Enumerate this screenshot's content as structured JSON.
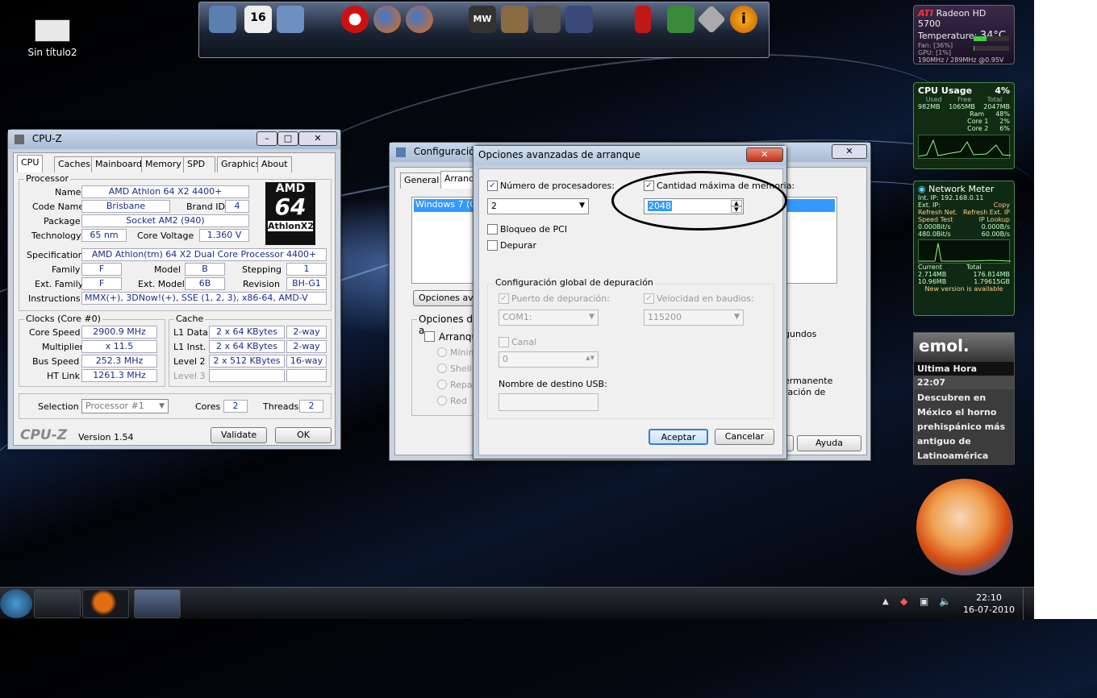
{
  "desktop": {
    "icon_label": "Sin título2"
  },
  "cpuz": {
    "title": "CPU-Z",
    "tabs": [
      "CPU",
      "Caches",
      "Mainboard",
      "Memory",
      "SPD",
      "Graphics",
      "About"
    ],
    "processor_group": "Processor",
    "name_label": "Name",
    "name": "AMD Athlon 64 X2 4400+",
    "codename_label": "Code Name",
    "codename": "Brisbane",
    "brandid_label": "Brand ID",
    "brandid": "4",
    "package_label": "Package",
    "package": "Socket AM2 (940)",
    "technology_label": "Technology",
    "technology": "65 nm",
    "voltage_label": "Core Voltage",
    "voltage": "1.360 V",
    "spec_label": "Specification",
    "spec": "AMD Athlon(tm) 64 X2 Dual Core Processor 4400+",
    "family_label": "Family",
    "family": "F",
    "model_label": "Model",
    "model": "B",
    "stepping_label": "Stepping",
    "stepping": "1",
    "extfamily_label": "Ext. Family",
    "extfamily": "F",
    "extmodel_label": "Ext. Model",
    "extmodel": "6B",
    "revision_label": "Revision",
    "revision": "BH-G1",
    "instructions_label": "Instructions",
    "instructions": "MMX(+), 3DNow!(+), SSE (1, 2, 3), x86-64, AMD-V",
    "logo_line1": "AMD",
    "logo_line2": "64",
    "logo_line3": "AthlonX2",
    "clocks_group": "Clocks (Core #0)",
    "corespeed_label": "Core Speed",
    "corespeed": "2900.9 MHz",
    "multiplier_label": "Multiplier",
    "multiplier": "x 11.5",
    "busspeed_label": "Bus Speed",
    "busspeed": "252.3 MHz",
    "htlink_label": "HT Link",
    "htlink": "1261.3 MHz",
    "cache_group": "Cache",
    "l1d_label": "L1 Data",
    "l1d": "2 x 64 KBytes",
    "l1d_way": "2-way",
    "l1i_label": "L1 Inst.",
    "l1i": "2 x 64 KBytes",
    "l1i_way": "2-way",
    "l2_label": "Level 2",
    "l2": "2 x 512 KBytes",
    "l2_way": "16-way",
    "l3_label": "Level 3",
    "selection_label": "Selection",
    "selection": "Processor #1",
    "cores_label": "Cores",
    "cores": "2",
    "threads_label": "Threads",
    "threads": "2",
    "brand": "CPU-Z",
    "version": "Version 1.54",
    "validate": "Validate",
    "ok": "OK"
  },
  "config": {
    "title": "Configuración",
    "tabs": [
      "General",
      "Arranque"
    ],
    "list_item": "Windows 7 (C:",
    "advanced_btn": "Opciones avan",
    "boot_options_label": "Opciones de a",
    "safe_boot": "Arranque",
    "radios": [
      "Mínimo",
      "Shell a",
      "Repar",
      "Red"
    ],
    "seconds_text": "gundos",
    "perm_text1": "ermanente",
    "perm_text2": "ración de",
    "help": "Ayuda"
  },
  "advanced": {
    "title": "Opciones avanzadas de arranque",
    "num_procs_label": "Número de procesadores:",
    "num_procs_value": "2",
    "max_mem_label": "Cantidad máxima de memoria:",
    "max_mem_value": "2048",
    "pci_lock": "Bloqueo de PCI",
    "debug": "Depurar",
    "debug_group": "Configuración global de depuración",
    "debug_port_label": "Puerto de depuración:",
    "debug_port_value": "COM1:",
    "baud_label": "Velocidad en baudios:",
    "baud_value": "115200",
    "channel_label": "Canal",
    "channel_value": "0",
    "usb_label": "Nombre de destino USB:",
    "accept": "Aceptar",
    "cancel": "Cancelar"
  },
  "gadgets": {
    "ati_brand": "ATI",
    "ati_title": "Radeon HD 5700",
    "ati_temp_label": "Temperature:",
    "ati_temp": "34°C",
    "ati_fan": "Fan: [36%]",
    "ati_gpu": "GPU: [1%]",
    "ati_clock": "190MHz / 289MHz @0.95V",
    "cpu_title": "CPU Usage",
    "cpu_pct": "4%",
    "cpu_used_label": "Used",
    "cpu_free_label": "Free",
    "cpu_total_label": "Total",
    "cpu_used": "982MB",
    "cpu_free": "1065MB",
    "cpu_total": "2047MB",
    "ram_label": "Ram",
    "ram_pct": "48%",
    "core1_label": "Core 1",
    "core1_pct": "2%",
    "core2_label": "Core 2",
    "core2_pct": "6%",
    "net_title": "Network Meter",
    "net_ip": "Int. IP: 192.168.0.11",
    "net_ext": "Ext. IP:",
    "net_copy": "Copy",
    "net_refresh": "Refresh Net.",
    "net_refresh_ext": "Refresh Ext. IP",
    "net_speed": "Speed Test",
    "net_lookup": "IP Lookup",
    "net_up1": "0.000Bit/s",
    "net_up2": "0.000B/s",
    "net_down1": "480.0Bit/s",
    "net_down2": "60.00B/s",
    "net_current": "Current",
    "net_total": "Total",
    "net_c_up": "2.714MB",
    "net_t_up": "176.814MB",
    "net_c_down": "10.96MB",
    "net_t_down": "1.79615GB",
    "net_version": "New version is available",
    "emol_brand": "emol.",
    "emol_header": "Ultima Hora",
    "emol_time": "22:07",
    "emol_headline": "Descubren en México el horno prehispánico más antiguo de Latinoamérica"
  },
  "dock": {
    "calendar_day": "16",
    "mw_text": "MW"
  },
  "taskbar": {
    "time": "22:10",
    "date": "16-07-2010"
  },
  "colors": {
    "accent": "#3a7bd5",
    "selection": "#3399ff"
  }
}
